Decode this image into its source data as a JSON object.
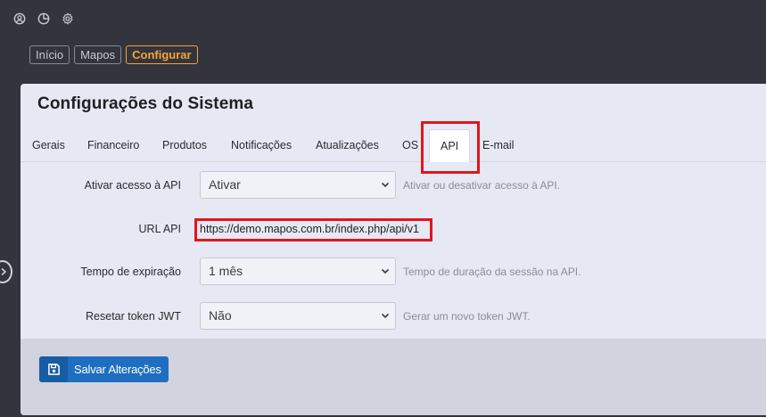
{
  "top_icons": [
    "user-circle-icon",
    "pie-chart-icon",
    "gear-icon"
  ],
  "breadcrumb": {
    "items": [
      {
        "label": "Início"
      },
      {
        "label": "Mapos"
      },
      {
        "label": "Configurar"
      }
    ]
  },
  "page": {
    "title": "Configurações do Sistema"
  },
  "tabs": [
    {
      "label": "Gerais"
    },
    {
      "label": "Financeiro"
    },
    {
      "label": "Produtos"
    },
    {
      "label": "Notificações"
    },
    {
      "label": "Atualizações"
    },
    {
      "label": "OS"
    },
    {
      "label": "API"
    },
    {
      "label": "E-mail"
    }
  ],
  "active_tab": "API",
  "form": {
    "api_access": {
      "label": "Ativar acesso à API",
      "value": "Ativar",
      "help": "Ativar ou desativar acesso à API."
    },
    "api_url": {
      "label": "URL API",
      "value": "https://demo.mapos.com.br/index.php/api/v1"
    },
    "expiration": {
      "label": "Tempo de expiração",
      "value": "1 mês",
      "help": "Tempo de duração da sessão na API."
    },
    "reset_token": {
      "label": "Resetar token JWT",
      "value": "Não",
      "help": "Gerar um novo token JWT."
    }
  },
  "footer": {
    "save_label": "Salvar Alterações"
  },
  "colors": {
    "background": "#33343d",
    "card": "#e6e8f3",
    "accent_orange": "#f7a33a",
    "primary_button": "#1e6fc1",
    "highlight_red": "#e0161d"
  }
}
